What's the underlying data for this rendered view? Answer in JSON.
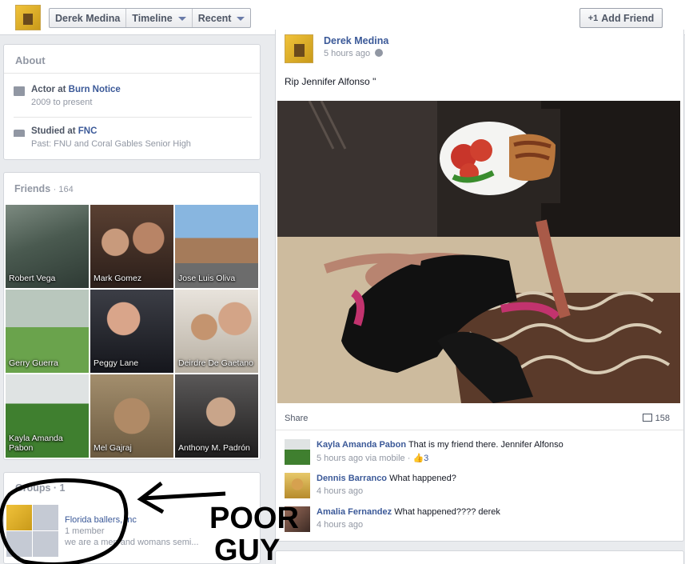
{
  "header": {
    "name": "Derek Medina",
    "timeline_label": "Timeline",
    "recent_label": "Recent",
    "add_friend_label": "Add Friend"
  },
  "about": {
    "title": "About",
    "work_prefix": "Actor at ",
    "work_place": "Burn Notice",
    "work_dates": "2009 to present",
    "edu_prefix": "Studied at ",
    "edu_place": "FNC",
    "edu_past": "Past: FNU and Coral Gables Senior High"
  },
  "friends": {
    "title": "Friends",
    "count": "· 164",
    "items": [
      {
        "name": "Robert Vega"
      },
      {
        "name": "Mark Gomez"
      },
      {
        "name": "Jose Luis Oliva"
      },
      {
        "name": "Gerry Guerra"
      },
      {
        "name": "Peggy Lane"
      },
      {
        "name": "Deirdre De Gaetano"
      },
      {
        "name": "Kayla Amanda Pabon"
      },
      {
        "name": "Mel Gajraj"
      },
      {
        "name": "Anthony M. Padrón"
      }
    ]
  },
  "groups": {
    "title": "Groups · 1",
    "name": "Florida ballers, Inc",
    "members": "1 member",
    "description": "we are a men and womans semi..."
  },
  "post": {
    "author": "Derek Medina",
    "time": "5 hours ago",
    "text": "Rip Jennifer Alfonso \"",
    "share_label": "Share",
    "comment_count": "158",
    "comments": [
      {
        "name": "Kayla Amanda Pabon",
        "text": "That is my friend there. Jennifer Alfonso",
        "meta": "5 hours ago via mobile · ",
        "likes": "3"
      },
      {
        "name": "Dennis Barranco",
        "text": "What happened?",
        "meta": "4 hours ago"
      },
      {
        "name": "Amalia Fernandez",
        "text": "What happened???? derek",
        "meta": "4 hours ago"
      }
    ]
  },
  "annotation": {
    "text_line1": "POOR",
    "text_line2": "GUY"
  },
  "colors": {
    "brand_link": "#3b5998",
    "muted": "#9197a3",
    "background": "#e9ebee"
  }
}
